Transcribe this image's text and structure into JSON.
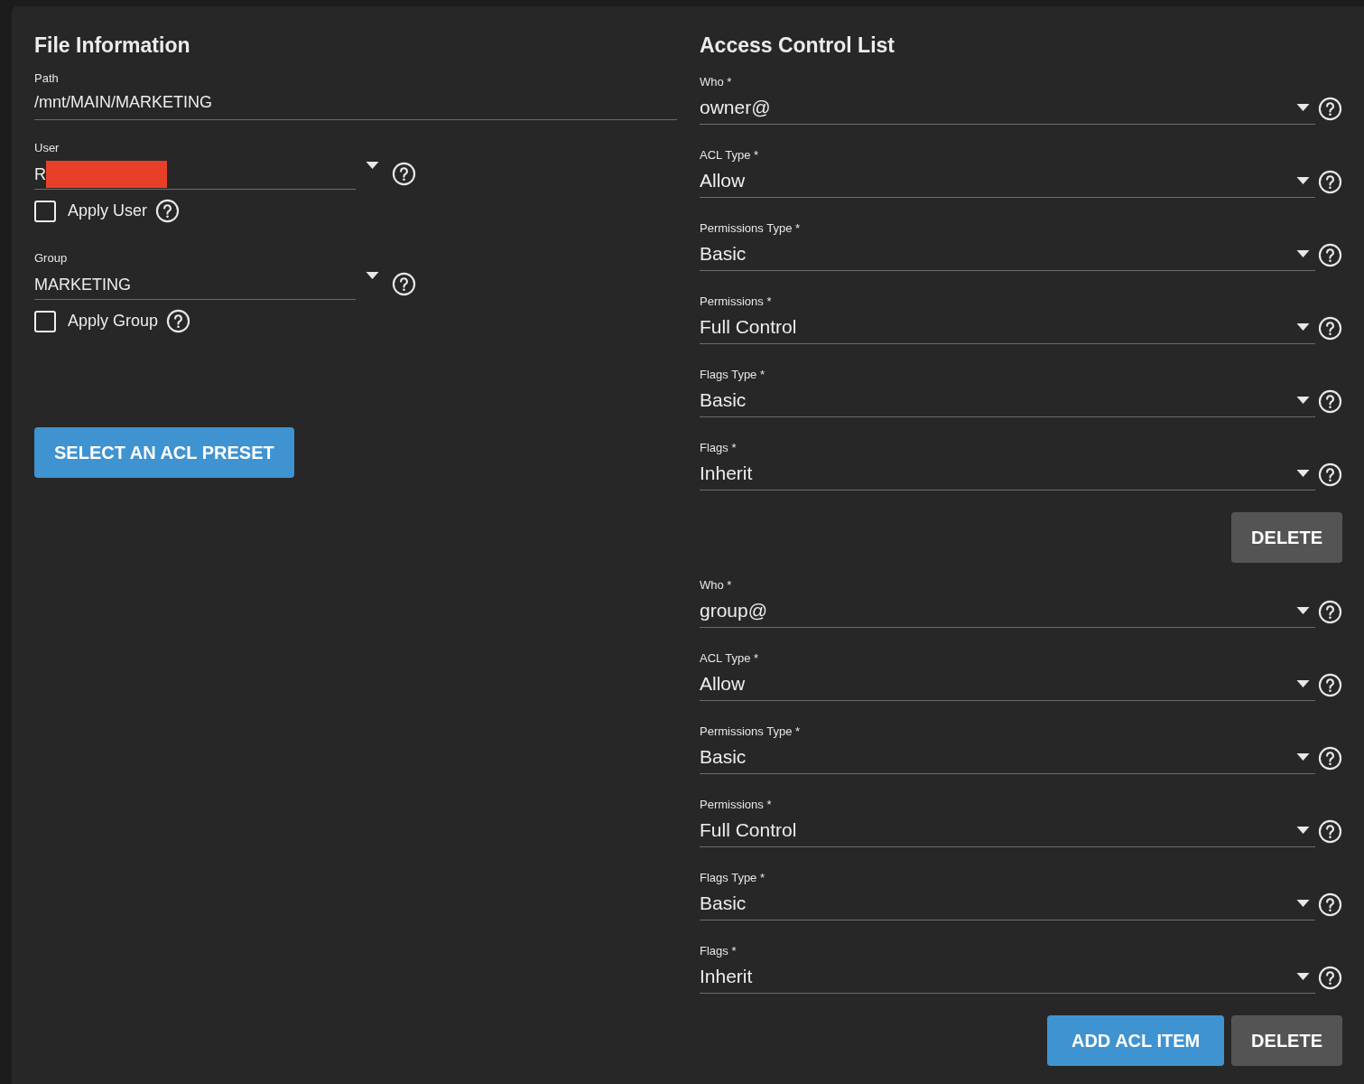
{
  "file_information": {
    "title": "File Information",
    "path": {
      "label": "Path",
      "value": "/mnt/MAIN/MARKETING"
    },
    "user": {
      "label": "User",
      "value": "R",
      "redacted": true,
      "apply": {
        "label": "Apply User",
        "checked": false
      }
    },
    "group": {
      "label": "Group",
      "value": "MARKETING",
      "apply": {
        "label": "Apply Group",
        "checked": false
      }
    },
    "preset_button": "SELECT AN ACL PRESET"
  },
  "access_control_list": {
    "title": "Access Control List",
    "items": [
      {
        "fields": [
          {
            "label": "Who *",
            "value": "owner@"
          },
          {
            "label": "ACL Type *",
            "value": "Allow"
          },
          {
            "label": "Permissions Type *",
            "value": "Basic"
          },
          {
            "label": "Permissions *",
            "value": "Full Control"
          },
          {
            "label": "Flags Type *",
            "value": "Basic"
          },
          {
            "label": "Flags *",
            "value": "Inherit"
          }
        ],
        "delete_button": "DELETE"
      },
      {
        "fields": [
          {
            "label": "Who *",
            "value": "group@"
          },
          {
            "label": "ACL Type *",
            "value": "Allow"
          },
          {
            "label": "Permissions Type *",
            "value": "Basic"
          },
          {
            "label": "Permissions *",
            "value": "Full Control"
          },
          {
            "label": "Flags Type *",
            "value": "Basic"
          },
          {
            "label": "Flags *",
            "value": "Inherit"
          }
        ],
        "delete_button": "DELETE"
      }
    ],
    "add_button": "ADD ACL ITEM"
  }
}
